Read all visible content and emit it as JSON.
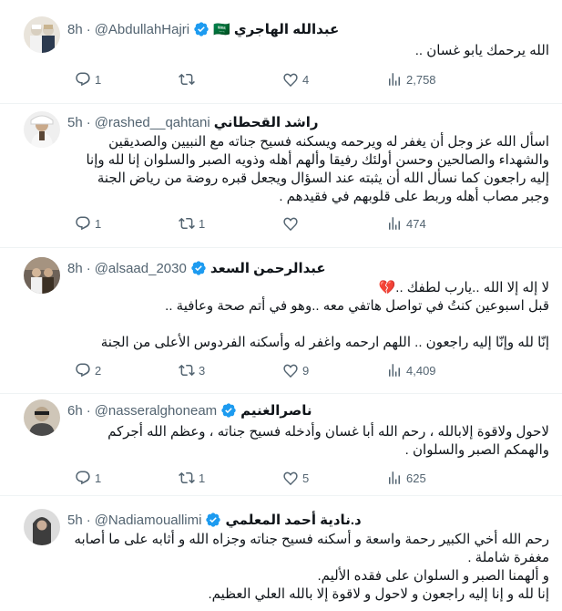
{
  "tweets": [
    {
      "name": "عبدالله الهاجري",
      "flag": "🇸🇦",
      "handle": "@AbdullahHajri",
      "time": "8h",
      "lines": [
        "الله يرحمك يابو غسان .."
      ],
      "replies": "1",
      "retweets": "",
      "likes": "4",
      "views": "2,758",
      "avatar_colors": [
        "#c9b48f",
        "#2c3a4f"
      ]
    },
    {
      "name": "راشد القحطاني",
      "handle": "@rashed__qahtani",
      "time": "5h",
      "lines": [
        "اسأل الله عز وجل أن يغفر له ويرحمه ويسكنه فسيح جناته مع النبيين والصديقين",
        "والشهداء والصالحين وحسن أولئك رفيقا وألهم أهله وذويه الصبر والسلوان إنا لله وإنا",
        "إليه راجعون كما نسأل الله أن يثبته عند السؤال ويجعل قبره روضة من رياض الجنة",
        "وجبر مصاب أهله وربط على قلوبهم في فقيدهم ."
      ],
      "replies": "1",
      "retweets": "1",
      "likes": "",
      "views": "474",
      "avatar_colors": [
        "#d9d9d9",
        "#5a4636"
      ]
    },
    {
      "name": "عبدالرحمن السعد",
      "handle": "@alsaad_2030",
      "time": "8h",
      "lines": [
        "لا إله إلا الله ..يارب لطفك ..💔",
        "قبل اسبوعين كنتُ في تواصل هاتفي معه ..وهو في أتم صحة وعافية ..",
        "",
        "إنّا لله وإنّا إليه راجعون .. اللهم ارحمه واغفر له وأسكنه الفردوس الأعلى من الجنة"
      ],
      "replies": "2",
      "retweets": "3",
      "likes": "9",
      "views": "4,409",
      "avatar_colors": [
        "#8a7a68",
        "#3b3024"
      ]
    },
    {
      "name": "ناصرالغنيم",
      "handle": "@nasseralghoneam",
      "time": "6h",
      "lines": [
        "لاحول ولاقوة إلابالله ، رحم الله أبا غسان وأدخله فسيح جناته ، وعظم الله أجركم",
        "والهمكم الصبر والسلوان ."
      ],
      "replies": "1",
      "retweets": "1",
      "likes": "5",
      "views": "625",
      "avatar_colors": [
        "#4a4a4a",
        "#b8a58c"
      ]
    },
    {
      "name": "د.نادية أحمد المعلمي",
      "handle": "@Nadiamouallimi",
      "time": "5h",
      "lines": [
        "رحم الله أخي الكبير رحمة واسعة و أسكنه فسيح جناته وجزاه الله و أثابه على ما أصابه",
        "مغفرة شاملة .",
        "و ألهمنا الصبر و السلوان على فقده الأليم.",
        "إنا لله و إنا إليه راجعون و لاحول و لاقوة إلا بالله العلي العظيم."
      ],
      "replies": "",
      "retweets": "",
      "likes": "",
      "views": "",
      "avatar_colors": [
        "#3d3d3d",
        "#a08a7a"
      ]
    }
  ],
  "colors": {
    "verified": "#1d9bf0",
    "muted": "#536471",
    "text": "#0f1419",
    "divider": "#eff3f4"
  },
  "icons": {
    "reply": "reply-icon",
    "retweet": "retweet-icon",
    "like": "heart-icon",
    "views": "views-icon",
    "verified": "verified-badge-icon"
  }
}
